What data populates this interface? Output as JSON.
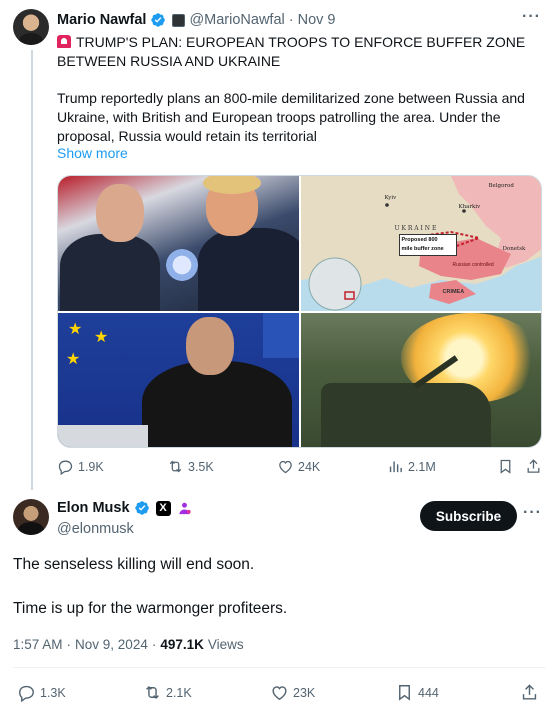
{
  "quoted": {
    "name": "Mario Nawfal",
    "handle": "@MarioNawfal",
    "separator": "·",
    "date": "Nov 9",
    "title": "TRUMP'S PLAN: EUROPEAN TROOPS TO ENFORCE BUFFER ZONE BETWEEN RUSSIA AND UKRAINE",
    "body": "Trump reportedly plans an 800-mile demilitarized zone between Russia and Ukraine, with British and European troops patrolling the area. Under the proposal, Russia would retain its territorial",
    "show_more": "Show more",
    "map": {
      "labels": {
        "kyiv": "Kyiv",
        "kharkiv": "Kharkiv",
        "belgorod": "Belgorod",
        "ukraine": "U K R A I N E",
        "donetsk": "Donetsk",
        "crimea": "CRIMEA",
        "russian_controlled": "Russian controlled",
        "buffer_line1": "Proposed 800",
        "buffer_line2": "mile buffer zone"
      }
    },
    "actions": {
      "replies": "1.9K",
      "reposts": "3.5K",
      "likes": "24K",
      "views": "2.1M"
    }
  },
  "tweet": {
    "name": "Elon Musk",
    "handle": "@elonmusk",
    "x_badge": "X",
    "subscribe_label": "Subscribe",
    "line1": "The senseless killing will end soon.",
    "line2": "Time is up for the warmonger profiteers.",
    "time": "1:57 AM",
    "separator": "·",
    "date": "Nov 9, 2024",
    "separator2": "·",
    "views_count": "497.1K",
    "views_label": "Views",
    "actions": {
      "replies": "1.3K",
      "reposts": "2.1K",
      "likes": "23K",
      "bookmarks": "444"
    }
  },
  "colors": {
    "accent": "#1d9bf0",
    "text": "#0f1419",
    "secondary": "#536471",
    "verified": "#1d9bf0"
  },
  "icons": [
    "verified-icon",
    "more-icon",
    "reply-icon",
    "repost-icon",
    "like-icon",
    "views-icon",
    "bookmark-icon",
    "share-icon",
    "siren-icon"
  ]
}
